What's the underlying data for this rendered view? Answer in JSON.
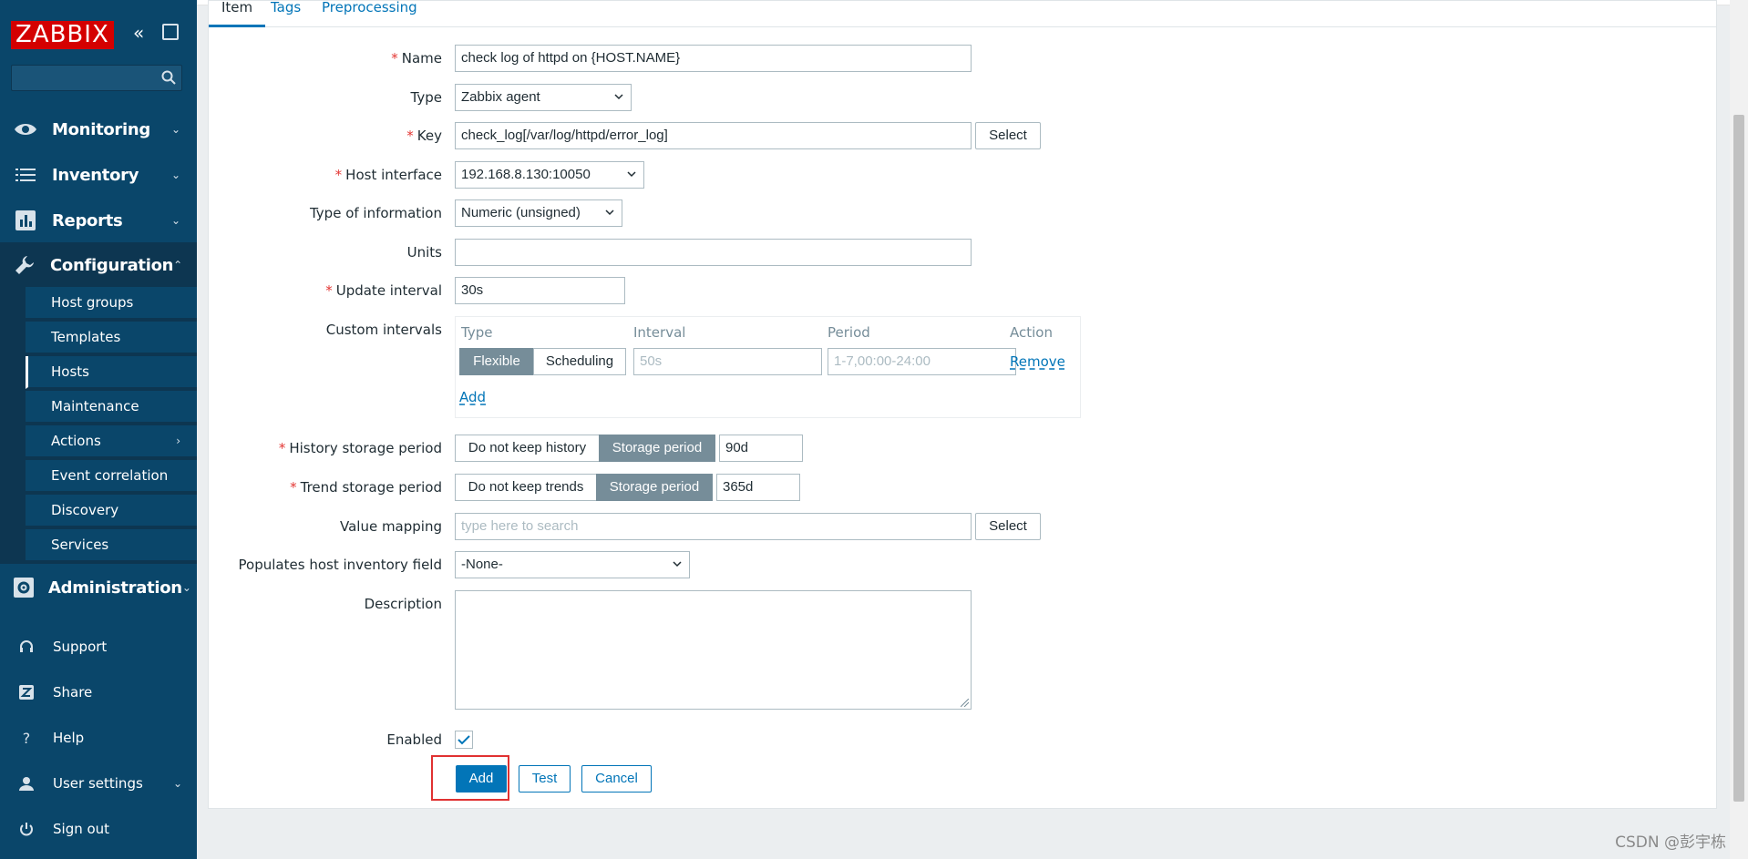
{
  "sidebar": {
    "logo": "ZABBIX",
    "search_placeholder": "",
    "nav": [
      {
        "label": "Monitoring",
        "icon": "eye-icon"
      },
      {
        "label": "Inventory",
        "icon": "list-icon"
      },
      {
        "label": "Reports",
        "icon": "bar-chart-icon"
      },
      {
        "label": "Configuration",
        "icon": "wrench-icon"
      },
      {
        "label": "Administration",
        "icon": "gear-icon"
      }
    ],
    "config_submenu": [
      "Host groups",
      "Templates",
      "Hosts",
      "Maintenance",
      "Actions",
      "Event correlation",
      "Discovery",
      "Services"
    ],
    "lower": [
      {
        "label": "Support",
        "icon": "headset-icon"
      },
      {
        "label": "Share",
        "icon": "share-z-icon"
      },
      {
        "label": "Help",
        "icon": "help-icon"
      },
      {
        "label": "User settings",
        "icon": "user-icon"
      },
      {
        "label": "Sign out",
        "icon": "power-icon"
      }
    ]
  },
  "tabs": [
    "Item",
    "Tags",
    "Preprocessing"
  ],
  "form": {
    "name_label": "Name",
    "name_value": "check log of httpd on {HOST.NAME}",
    "type_label": "Type",
    "type_value": "Zabbix agent",
    "key_label": "Key",
    "key_value": "check_log[/var/log/httpd/error_log]",
    "select_label": "Select",
    "host_interface_label": "Host interface",
    "host_interface_value": "192.168.8.130:10050",
    "type_info_label": "Type of information",
    "type_info_value": "Numeric (unsigned)",
    "units_label": "Units",
    "units_value": "",
    "update_interval_label": "Update interval",
    "update_interval_value": "30s",
    "custom_intervals_label": "Custom intervals",
    "ci_headers": [
      "Type",
      "Interval",
      "Period",
      "Action"
    ],
    "ci_flexible": "Flexible",
    "ci_scheduling": "Scheduling",
    "ci_interval_placeholder": "50s",
    "ci_period_placeholder": "1-7,00:00-24:00",
    "ci_remove": "Remove",
    "ci_add": "Add",
    "history_label": "History storage period",
    "history_no_keep": "Do not keep history",
    "history_storage": "Storage period",
    "history_value": "90d",
    "trend_label": "Trend storage period",
    "trend_no_keep": "Do not keep trends",
    "trend_storage": "Storage period",
    "trend_value": "365d",
    "value_mapping_label": "Value mapping",
    "value_mapping_placeholder": "type here to search",
    "inventory_label": "Populates host inventory field",
    "inventory_value": "-None-",
    "description_label": "Description",
    "enabled_label": "Enabled",
    "add_button": "Add",
    "test_button": "Test",
    "cancel_button": "Cancel"
  },
  "watermark": "CSDN @彭宇栋",
  "colors": {
    "sidebar": "#0a466a",
    "accent": "#0275b8",
    "required": "#e33734",
    "logo": "#d40000"
  }
}
